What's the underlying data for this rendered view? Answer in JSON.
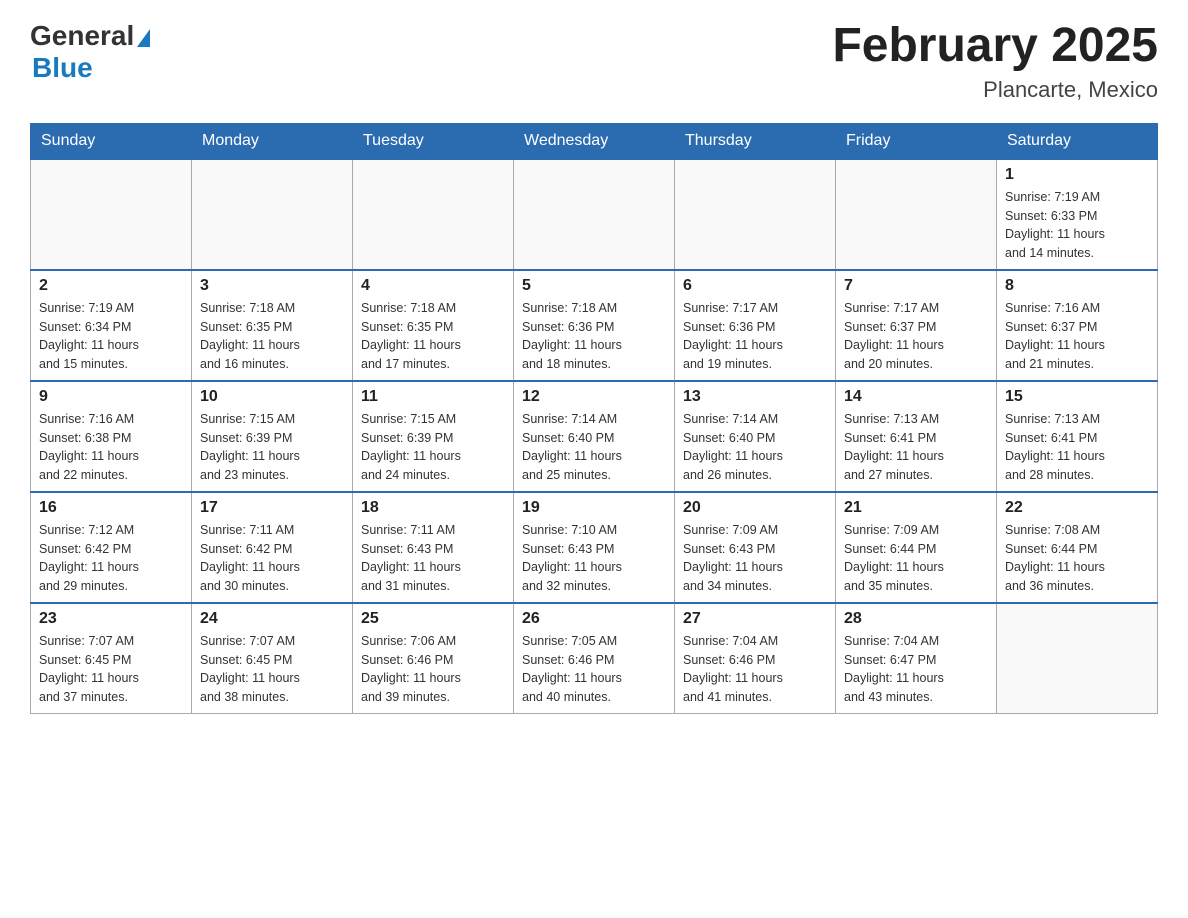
{
  "header": {
    "logo_general": "General",
    "logo_blue": "Blue",
    "title": "February 2025",
    "subtitle": "Plancarte, Mexico"
  },
  "days_of_week": [
    "Sunday",
    "Monday",
    "Tuesday",
    "Wednesday",
    "Thursday",
    "Friday",
    "Saturday"
  ],
  "weeks": [
    [
      {
        "day": "",
        "info": ""
      },
      {
        "day": "",
        "info": ""
      },
      {
        "day": "",
        "info": ""
      },
      {
        "day": "",
        "info": ""
      },
      {
        "day": "",
        "info": ""
      },
      {
        "day": "",
        "info": ""
      },
      {
        "day": "1",
        "info": "Sunrise: 7:19 AM\nSunset: 6:33 PM\nDaylight: 11 hours\nand 14 minutes."
      }
    ],
    [
      {
        "day": "2",
        "info": "Sunrise: 7:19 AM\nSunset: 6:34 PM\nDaylight: 11 hours\nand 15 minutes."
      },
      {
        "day": "3",
        "info": "Sunrise: 7:18 AM\nSunset: 6:35 PM\nDaylight: 11 hours\nand 16 minutes."
      },
      {
        "day": "4",
        "info": "Sunrise: 7:18 AM\nSunset: 6:35 PM\nDaylight: 11 hours\nand 17 minutes."
      },
      {
        "day": "5",
        "info": "Sunrise: 7:18 AM\nSunset: 6:36 PM\nDaylight: 11 hours\nand 18 minutes."
      },
      {
        "day": "6",
        "info": "Sunrise: 7:17 AM\nSunset: 6:36 PM\nDaylight: 11 hours\nand 19 minutes."
      },
      {
        "day": "7",
        "info": "Sunrise: 7:17 AM\nSunset: 6:37 PM\nDaylight: 11 hours\nand 20 minutes."
      },
      {
        "day": "8",
        "info": "Sunrise: 7:16 AM\nSunset: 6:37 PM\nDaylight: 11 hours\nand 21 minutes."
      }
    ],
    [
      {
        "day": "9",
        "info": "Sunrise: 7:16 AM\nSunset: 6:38 PM\nDaylight: 11 hours\nand 22 minutes."
      },
      {
        "day": "10",
        "info": "Sunrise: 7:15 AM\nSunset: 6:39 PM\nDaylight: 11 hours\nand 23 minutes."
      },
      {
        "day": "11",
        "info": "Sunrise: 7:15 AM\nSunset: 6:39 PM\nDaylight: 11 hours\nand 24 minutes."
      },
      {
        "day": "12",
        "info": "Sunrise: 7:14 AM\nSunset: 6:40 PM\nDaylight: 11 hours\nand 25 minutes."
      },
      {
        "day": "13",
        "info": "Sunrise: 7:14 AM\nSunset: 6:40 PM\nDaylight: 11 hours\nand 26 minutes."
      },
      {
        "day": "14",
        "info": "Sunrise: 7:13 AM\nSunset: 6:41 PM\nDaylight: 11 hours\nand 27 minutes."
      },
      {
        "day": "15",
        "info": "Sunrise: 7:13 AM\nSunset: 6:41 PM\nDaylight: 11 hours\nand 28 minutes."
      }
    ],
    [
      {
        "day": "16",
        "info": "Sunrise: 7:12 AM\nSunset: 6:42 PM\nDaylight: 11 hours\nand 29 minutes."
      },
      {
        "day": "17",
        "info": "Sunrise: 7:11 AM\nSunset: 6:42 PM\nDaylight: 11 hours\nand 30 minutes."
      },
      {
        "day": "18",
        "info": "Sunrise: 7:11 AM\nSunset: 6:43 PM\nDaylight: 11 hours\nand 31 minutes."
      },
      {
        "day": "19",
        "info": "Sunrise: 7:10 AM\nSunset: 6:43 PM\nDaylight: 11 hours\nand 32 minutes."
      },
      {
        "day": "20",
        "info": "Sunrise: 7:09 AM\nSunset: 6:43 PM\nDaylight: 11 hours\nand 34 minutes."
      },
      {
        "day": "21",
        "info": "Sunrise: 7:09 AM\nSunset: 6:44 PM\nDaylight: 11 hours\nand 35 minutes."
      },
      {
        "day": "22",
        "info": "Sunrise: 7:08 AM\nSunset: 6:44 PM\nDaylight: 11 hours\nand 36 minutes."
      }
    ],
    [
      {
        "day": "23",
        "info": "Sunrise: 7:07 AM\nSunset: 6:45 PM\nDaylight: 11 hours\nand 37 minutes."
      },
      {
        "day": "24",
        "info": "Sunrise: 7:07 AM\nSunset: 6:45 PM\nDaylight: 11 hours\nand 38 minutes."
      },
      {
        "day": "25",
        "info": "Sunrise: 7:06 AM\nSunset: 6:46 PM\nDaylight: 11 hours\nand 39 minutes."
      },
      {
        "day": "26",
        "info": "Sunrise: 7:05 AM\nSunset: 6:46 PM\nDaylight: 11 hours\nand 40 minutes."
      },
      {
        "day": "27",
        "info": "Sunrise: 7:04 AM\nSunset: 6:46 PM\nDaylight: 11 hours\nand 41 minutes."
      },
      {
        "day": "28",
        "info": "Sunrise: 7:04 AM\nSunset: 6:47 PM\nDaylight: 11 hours\nand 43 minutes."
      },
      {
        "day": "",
        "info": ""
      }
    ]
  ]
}
